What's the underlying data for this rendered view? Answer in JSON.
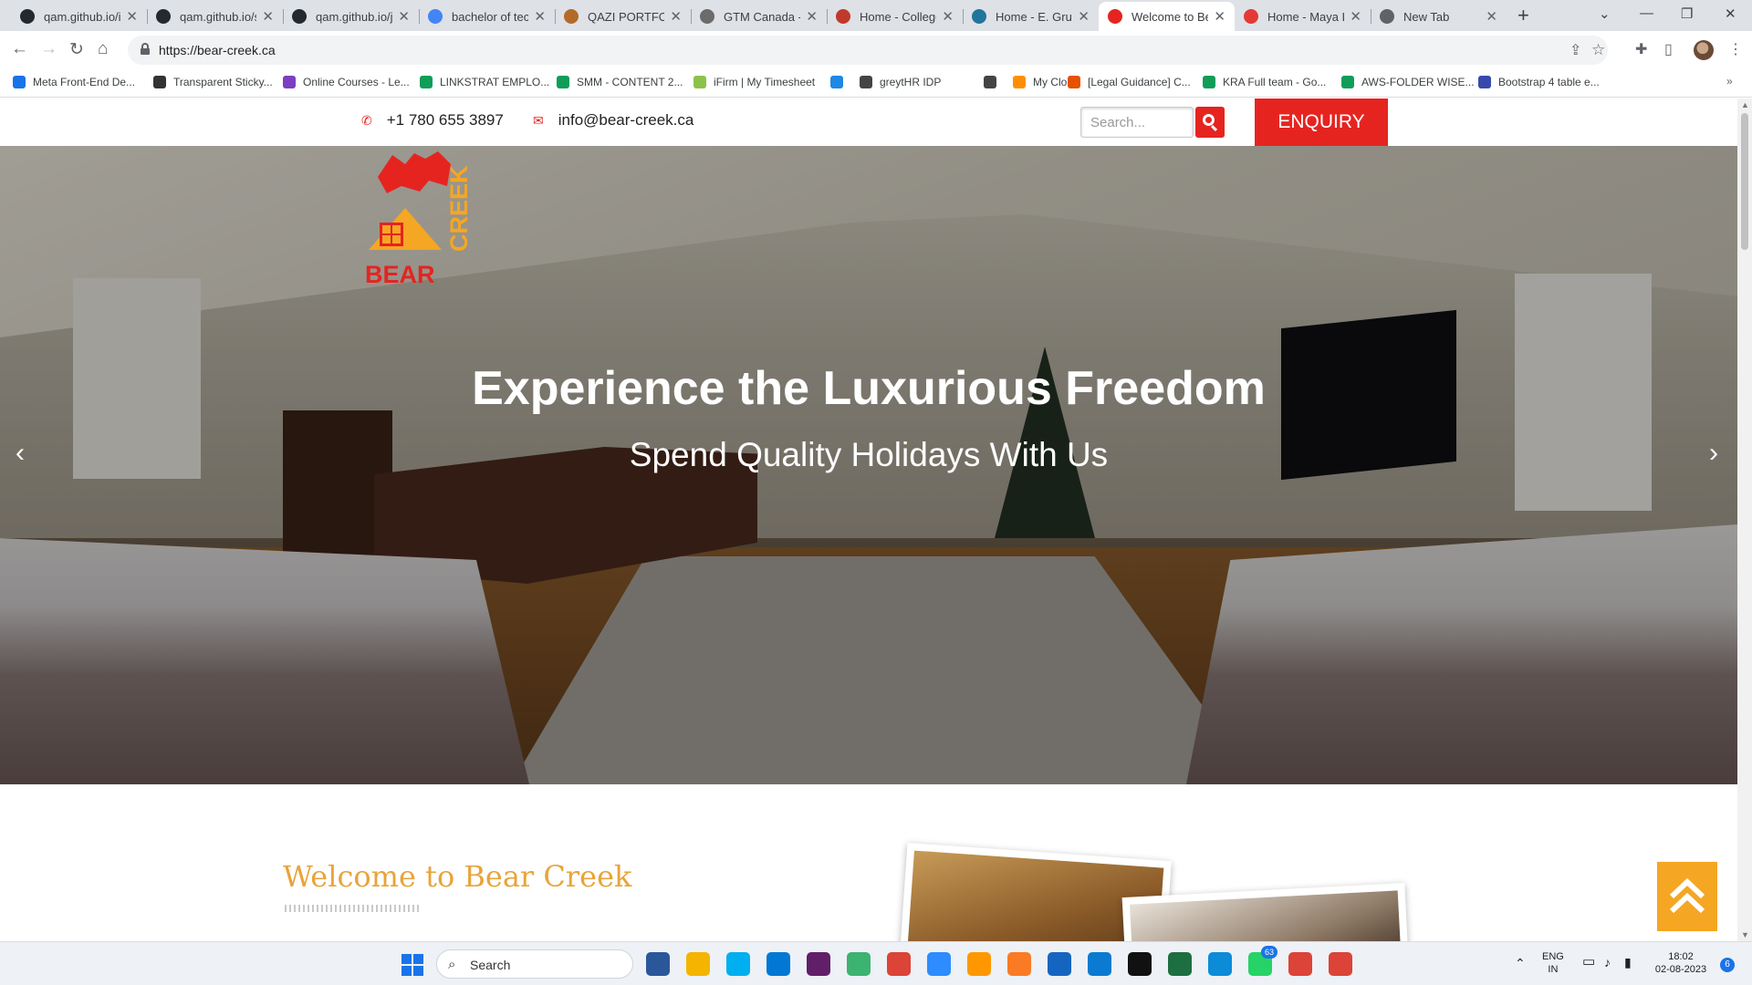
{
  "browser": {
    "tabs": [
      {
        "label": "qam.github.io/i",
        "favicon": "github-icon",
        "color": "#24292f"
      },
      {
        "label": "qam.github.io/s",
        "favicon": "github-icon",
        "color": "#24292f"
      },
      {
        "label": "qam.github.io/j",
        "favicon": "github-icon",
        "color": "#24292f"
      },
      {
        "label": "bachelor of tec",
        "favicon": "google-icon",
        "color": "#4285f4"
      },
      {
        "label": "QAZI PORTFOLI",
        "favicon": "portfolio-icon",
        "color": "#b36b2c"
      },
      {
        "label": "GTM Canada - I",
        "favicon": "gtm-icon",
        "color": "#6b6b6b"
      },
      {
        "label": "Home - College",
        "favicon": "college-icon",
        "color": "#c0392b"
      },
      {
        "label": "Home - E. Grub",
        "favicon": "wordpress-icon",
        "color": "#21759b"
      },
      {
        "label": "Welcome to Be",
        "favicon": "bear-creek-icon",
        "color": "#e52420"
      },
      {
        "label": "Home - Maya D",
        "favicon": "maya-icon",
        "color": "#e53935"
      },
      {
        "label": "New Tab",
        "favicon": "chrome-icon",
        "color": "#5f6368"
      }
    ],
    "active_tab_index": 8,
    "url": "https://bear-creek.ca",
    "bookmarks": [
      {
        "label": "Meta Front-End De...",
        "color": "#1a73e8"
      },
      {
        "label": "Transparent Sticky...",
        "color": "#333333"
      },
      {
        "label": "Online Courses - Le...",
        "color": "#7b3fbf"
      },
      {
        "label": "LINKSTRAT EMPLO...",
        "color": "#0f9d58"
      },
      {
        "label": "SMM - CONTENT 2...",
        "color": "#0f9d58"
      },
      {
        "label": "iFirm | My Timesheet",
        "color": "#8bc34a"
      },
      {
        "label": "",
        "color": "#1e88e5"
      },
      {
        "label": "greytHR IDP",
        "color": "#444444"
      },
      {
        "label": "",
        "color": "#444444"
      },
      {
        "label": "My Cloud",
        "color": "#ff8f00"
      },
      {
        "label": "[Legal Guidance] C...",
        "color": "#e65100"
      },
      {
        "label": "KRA Full team - Go...",
        "color": "#0f9d58"
      },
      {
        "label": "AWS-FOLDER WISE...",
        "color": "#0f9d58"
      },
      {
        "label": "Bootstrap 4 table e...",
        "color": "#3949ab"
      }
    ]
  },
  "site": {
    "phone": "+1 780 655 3897",
    "email": "info@bear-creek.ca",
    "search_placeholder": "Search...",
    "enquiry_label": "ENQUIRY",
    "logo_text_top": "CREEK",
    "logo_text_bottom": "BEAR",
    "hero_title": "Experience the Luxurious Freedom",
    "hero_subtitle": "Spend Quality Holidays With Us",
    "welcome_heading": "Welcome to Bear Creek",
    "colors": {
      "brand_red": "#e52420",
      "accent_orange": "#f5a623",
      "heading_orange": "#e8a43a"
    }
  },
  "taskbar": {
    "search_label": "Search",
    "apps": [
      {
        "name": "word-icon",
        "color": "#2b579a"
      },
      {
        "name": "file-explorer-icon",
        "color": "#f4b400"
      },
      {
        "name": "skype-icon",
        "color": "#00aff0"
      },
      {
        "name": "outlook-icon",
        "color": "#0078d4"
      },
      {
        "name": "slack-icon",
        "color": "#611f69"
      },
      {
        "name": "spotify-icon",
        "color": "#3cb371"
      },
      {
        "name": "chrome-icon",
        "color": "#db4437"
      },
      {
        "name": "zoom-icon",
        "color": "#2d8cff"
      },
      {
        "name": "sublime-icon",
        "color": "#ff9800"
      },
      {
        "name": "xampp-icon",
        "color": "#fb7a24"
      },
      {
        "name": "notepad-icon",
        "color": "#1565c0"
      },
      {
        "name": "vscode-icon",
        "color": "#0a7bd1"
      },
      {
        "name": "terminal-icon",
        "color": "#111111"
      },
      {
        "name": "excel-icon",
        "color": "#1d6f42"
      },
      {
        "name": "edge-icon",
        "color": "#0c8bd8"
      },
      {
        "name": "whatsapp-icon",
        "color": "#25d366"
      },
      {
        "name": "chrome-profile-icon",
        "color": "#db4437"
      },
      {
        "name": "chrome-profile-2-icon",
        "color": "#db4437"
      }
    ],
    "whatsapp_badge": "63",
    "lang_line1": "ENG",
    "lang_line2": "IN",
    "time": "18:02",
    "date": "02-08-2023",
    "notifications": "6"
  }
}
